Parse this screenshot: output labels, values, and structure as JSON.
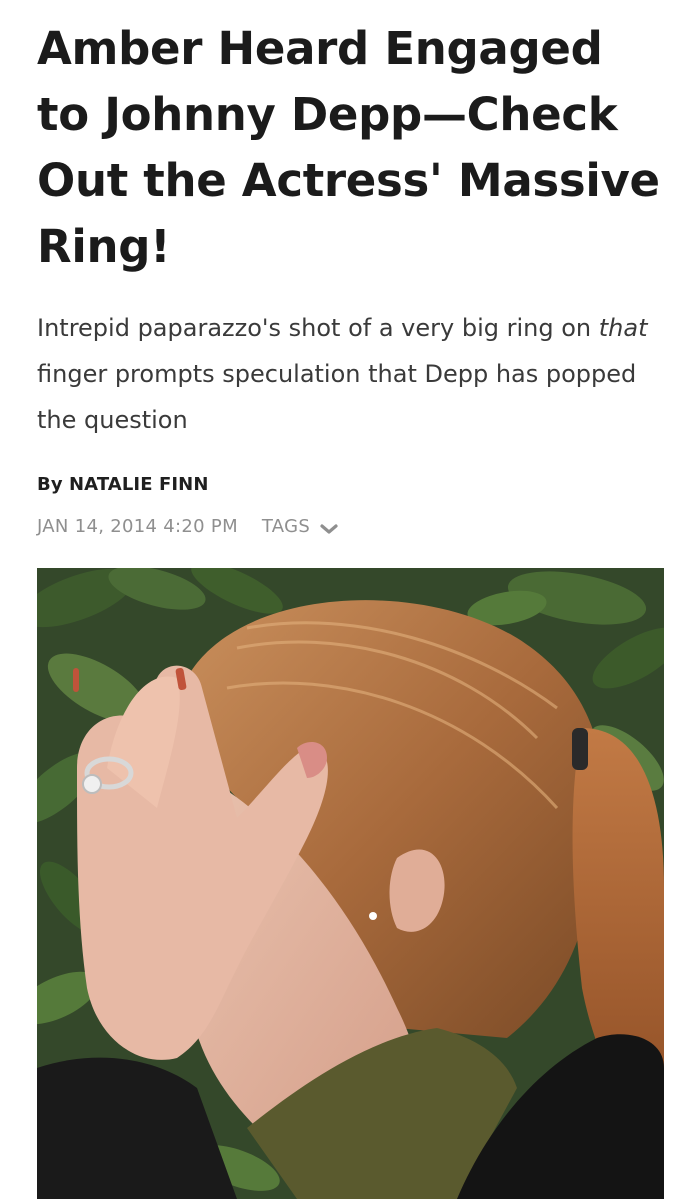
{
  "article": {
    "headline": "Amber Heard Engaged to Johnny Depp—Check Out the Actress' Massive Ring!",
    "dek_before": "Intrepid paparazzo's shot of a very big ring on ",
    "dek_em": "that",
    "dek_after": " finger prompts speculation that Depp has popped the question",
    "byline": "By NATALIE FINN",
    "date": "JAN 14, 2014 4:20 PM",
    "tags_label": "TAGS",
    "tags_icon": "chevron-down-icon"
  },
  "photo": {
    "subject": "photo-of-woman-covering-face"
  },
  "colors": {
    "headline": "#1b1b1b",
    "meta": "#8f8f8f",
    "leaves": "#2f4a22"
  }
}
